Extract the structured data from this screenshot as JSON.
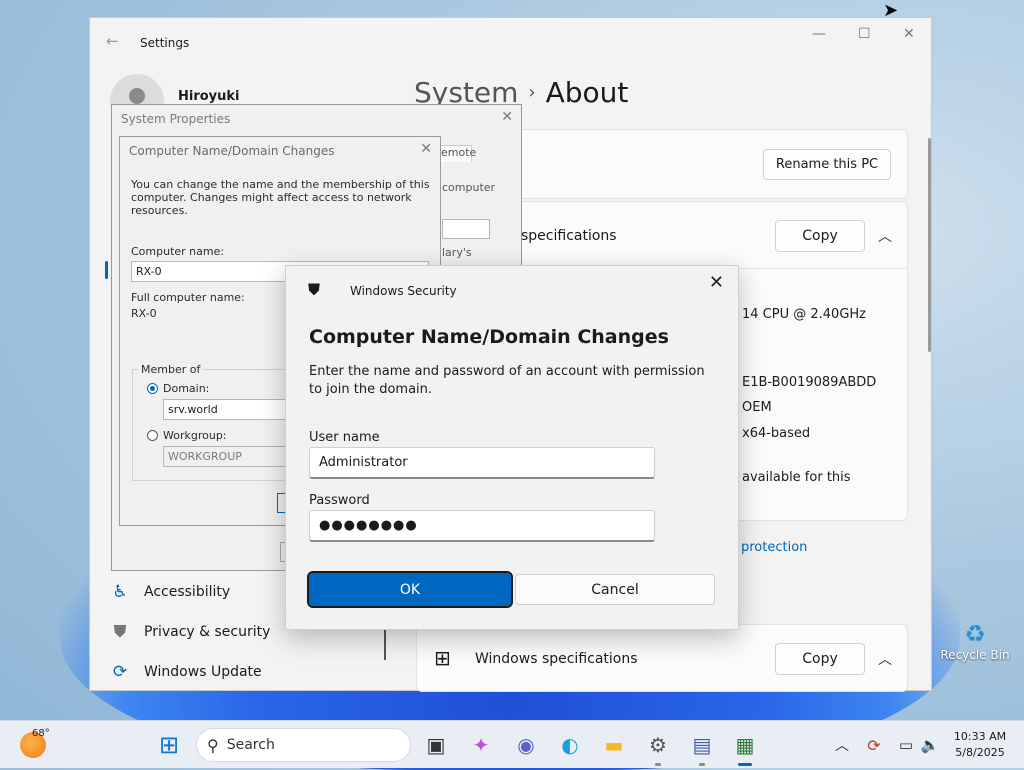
{
  "settings": {
    "title": "Settings",
    "user_name": "Hiroyuki",
    "breadcrumb_parent": "System",
    "breadcrumb_current": "About",
    "rename_button": "Rename this PC",
    "device_specs_title": "specifications",
    "copy_label": "Copy",
    "cpu_text": "14 CPU @ 2.40GHz",
    "device_id_text": "E1B-B0019089ABDD",
    "product_text": "OEM",
    "system_type_text": "x64-based",
    "pen_touch_text": "available for this",
    "protection_link": "protection",
    "windows_specs_title": "Windows specifications",
    "nav_items": [
      {
        "label": "Accessibility"
      },
      {
        "label": "Privacy & security"
      },
      {
        "label": "Windows Update"
      }
    ]
  },
  "system_properties": {
    "title": "System Properties",
    "tab_remote": "emote",
    "frag_computer": "computer",
    "frag_salary": "lary's"
  },
  "computer_name_dialog": {
    "title": "Computer Name/Domain Changes",
    "description": "You can change the name and the membership of this computer. Changes might affect access to network resources.",
    "computer_name_label": "Computer name:",
    "computer_name_value": "RX-0",
    "full_name_label": "Full computer name:",
    "full_name_value": "RX-0",
    "member_of_label": "Member of",
    "domain_label": "Domain:",
    "domain_value": "srv.world",
    "workgroup_label": "Workgroup:",
    "workgroup_value": "WORKGROUP"
  },
  "windows_security": {
    "header": "Windows Security",
    "title": "Computer Name/Domain Changes",
    "description": "Enter the name and password of an account with permission to join the domain.",
    "username_label": "User name",
    "username_value": "Administrator",
    "password_label": "Password",
    "password_value": "●●●●●●●●",
    "ok_label": "OK",
    "cancel_label": "Cancel"
  },
  "desktop": {
    "recycle_bin_label": "Recycle Bin"
  },
  "taskbar": {
    "temperature": "68°",
    "search_placeholder": "Search",
    "time": "10:33 AM",
    "date": "5/8/2025"
  },
  "colors": {
    "accent": "#0067c0",
    "window_bg": "#f3f3f3",
    "dialog_bg": "#f0f0f0"
  }
}
